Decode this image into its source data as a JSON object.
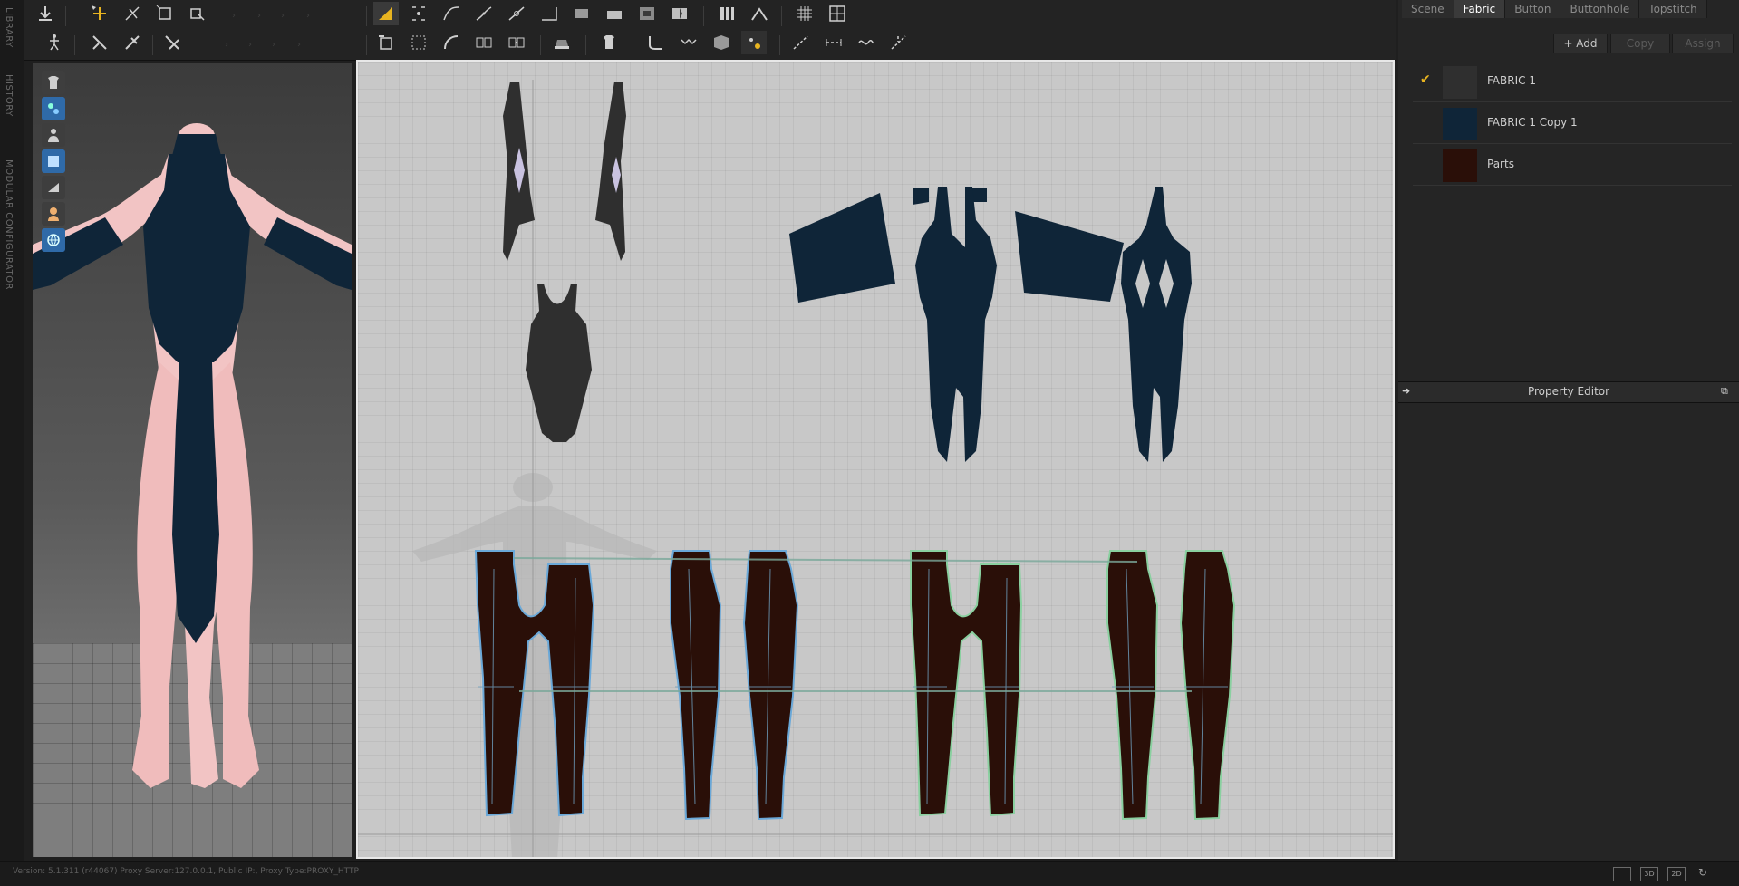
{
  "side_tabs": [
    "LIBRARY",
    "HISTORY",
    "MODULAR CONFIGURATOR"
  ],
  "object_tabs": [
    {
      "label": "Scene",
      "active": false
    },
    {
      "label": "Fabric",
      "active": true
    },
    {
      "label": "Button",
      "active": false
    },
    {
      "label": "Buttonhole",
      "active": false
    },
    {
      "label": "Topstitch",
      "active": false
    }
  ],
  "fabric_actions": {
    "add": "+ Add",
    "copy": "Copy",
    "assign": "Assign"
  },
  "fabrics": [
    {
      "name": "FABRIC 1",
      "color": "#2f2f2f",
      "selected": true
    },
    {
      "name": "FABRIC 1 Copy 1",
      "color": "#0f2538",
      "selected": false
    },
    {
      "name": "Parts",
      "color": "#2a0f08",
      "selected": false
    }
  ],
  "property_editor": {
    "title": "Property Editor"
  },
  "status": {
    "text": "Version: 5.1.311 (r44067)    Proxy Server:127.0.0.1, Public IP:, Proxy Type:PROXY_HTTP"
  },
  "view_modes": [
    "",
    "3D",
    "2D"
  ],
  "colors": {
    "accent": "#e8b420",
    "fabric_dark": "#0f2538",
    "fabric_grey": "#2f2f2f",
    "fabric_brown": "#2a0f08",
    "skin": "#f2c4c4"
  }
}
